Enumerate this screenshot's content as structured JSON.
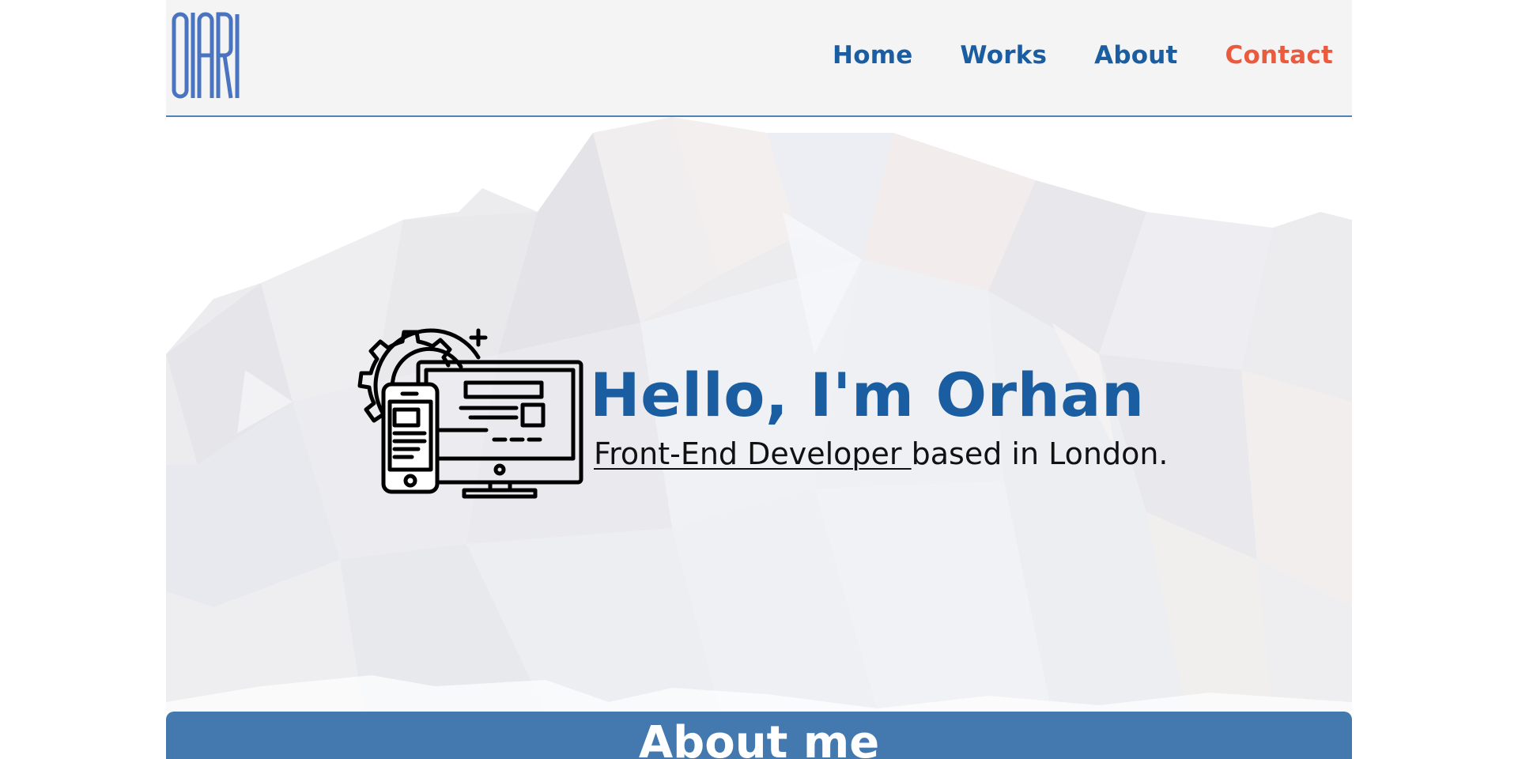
{
  "header": {
    "logo_text": "OIARI",
    "nav": [
      {
        "label": "Home"
      },
      {
        "label": "Works"
      },
      {
        "label": "About"
      },
      {
        "label": "Contact"
      }
    ]
  },
  "hero": {
    "title": "Hello, I'm Orhan",
    "subtitle_role": "Front-End Developer ",
    "subtitle_rest": "based in London."
  },
  "about": {
    "title": "About me"
  },
  "colors": {
    "brand": "#1a5da0",
    "accent": "#ea5b3e",
    "about_bar": "#4479b0",
    "header_bg": "#f4f4f4"
  },
  "icons": {
    "logo": "oari-logo-icon",
    "developer": "developer-devices-icon"
  }
}
